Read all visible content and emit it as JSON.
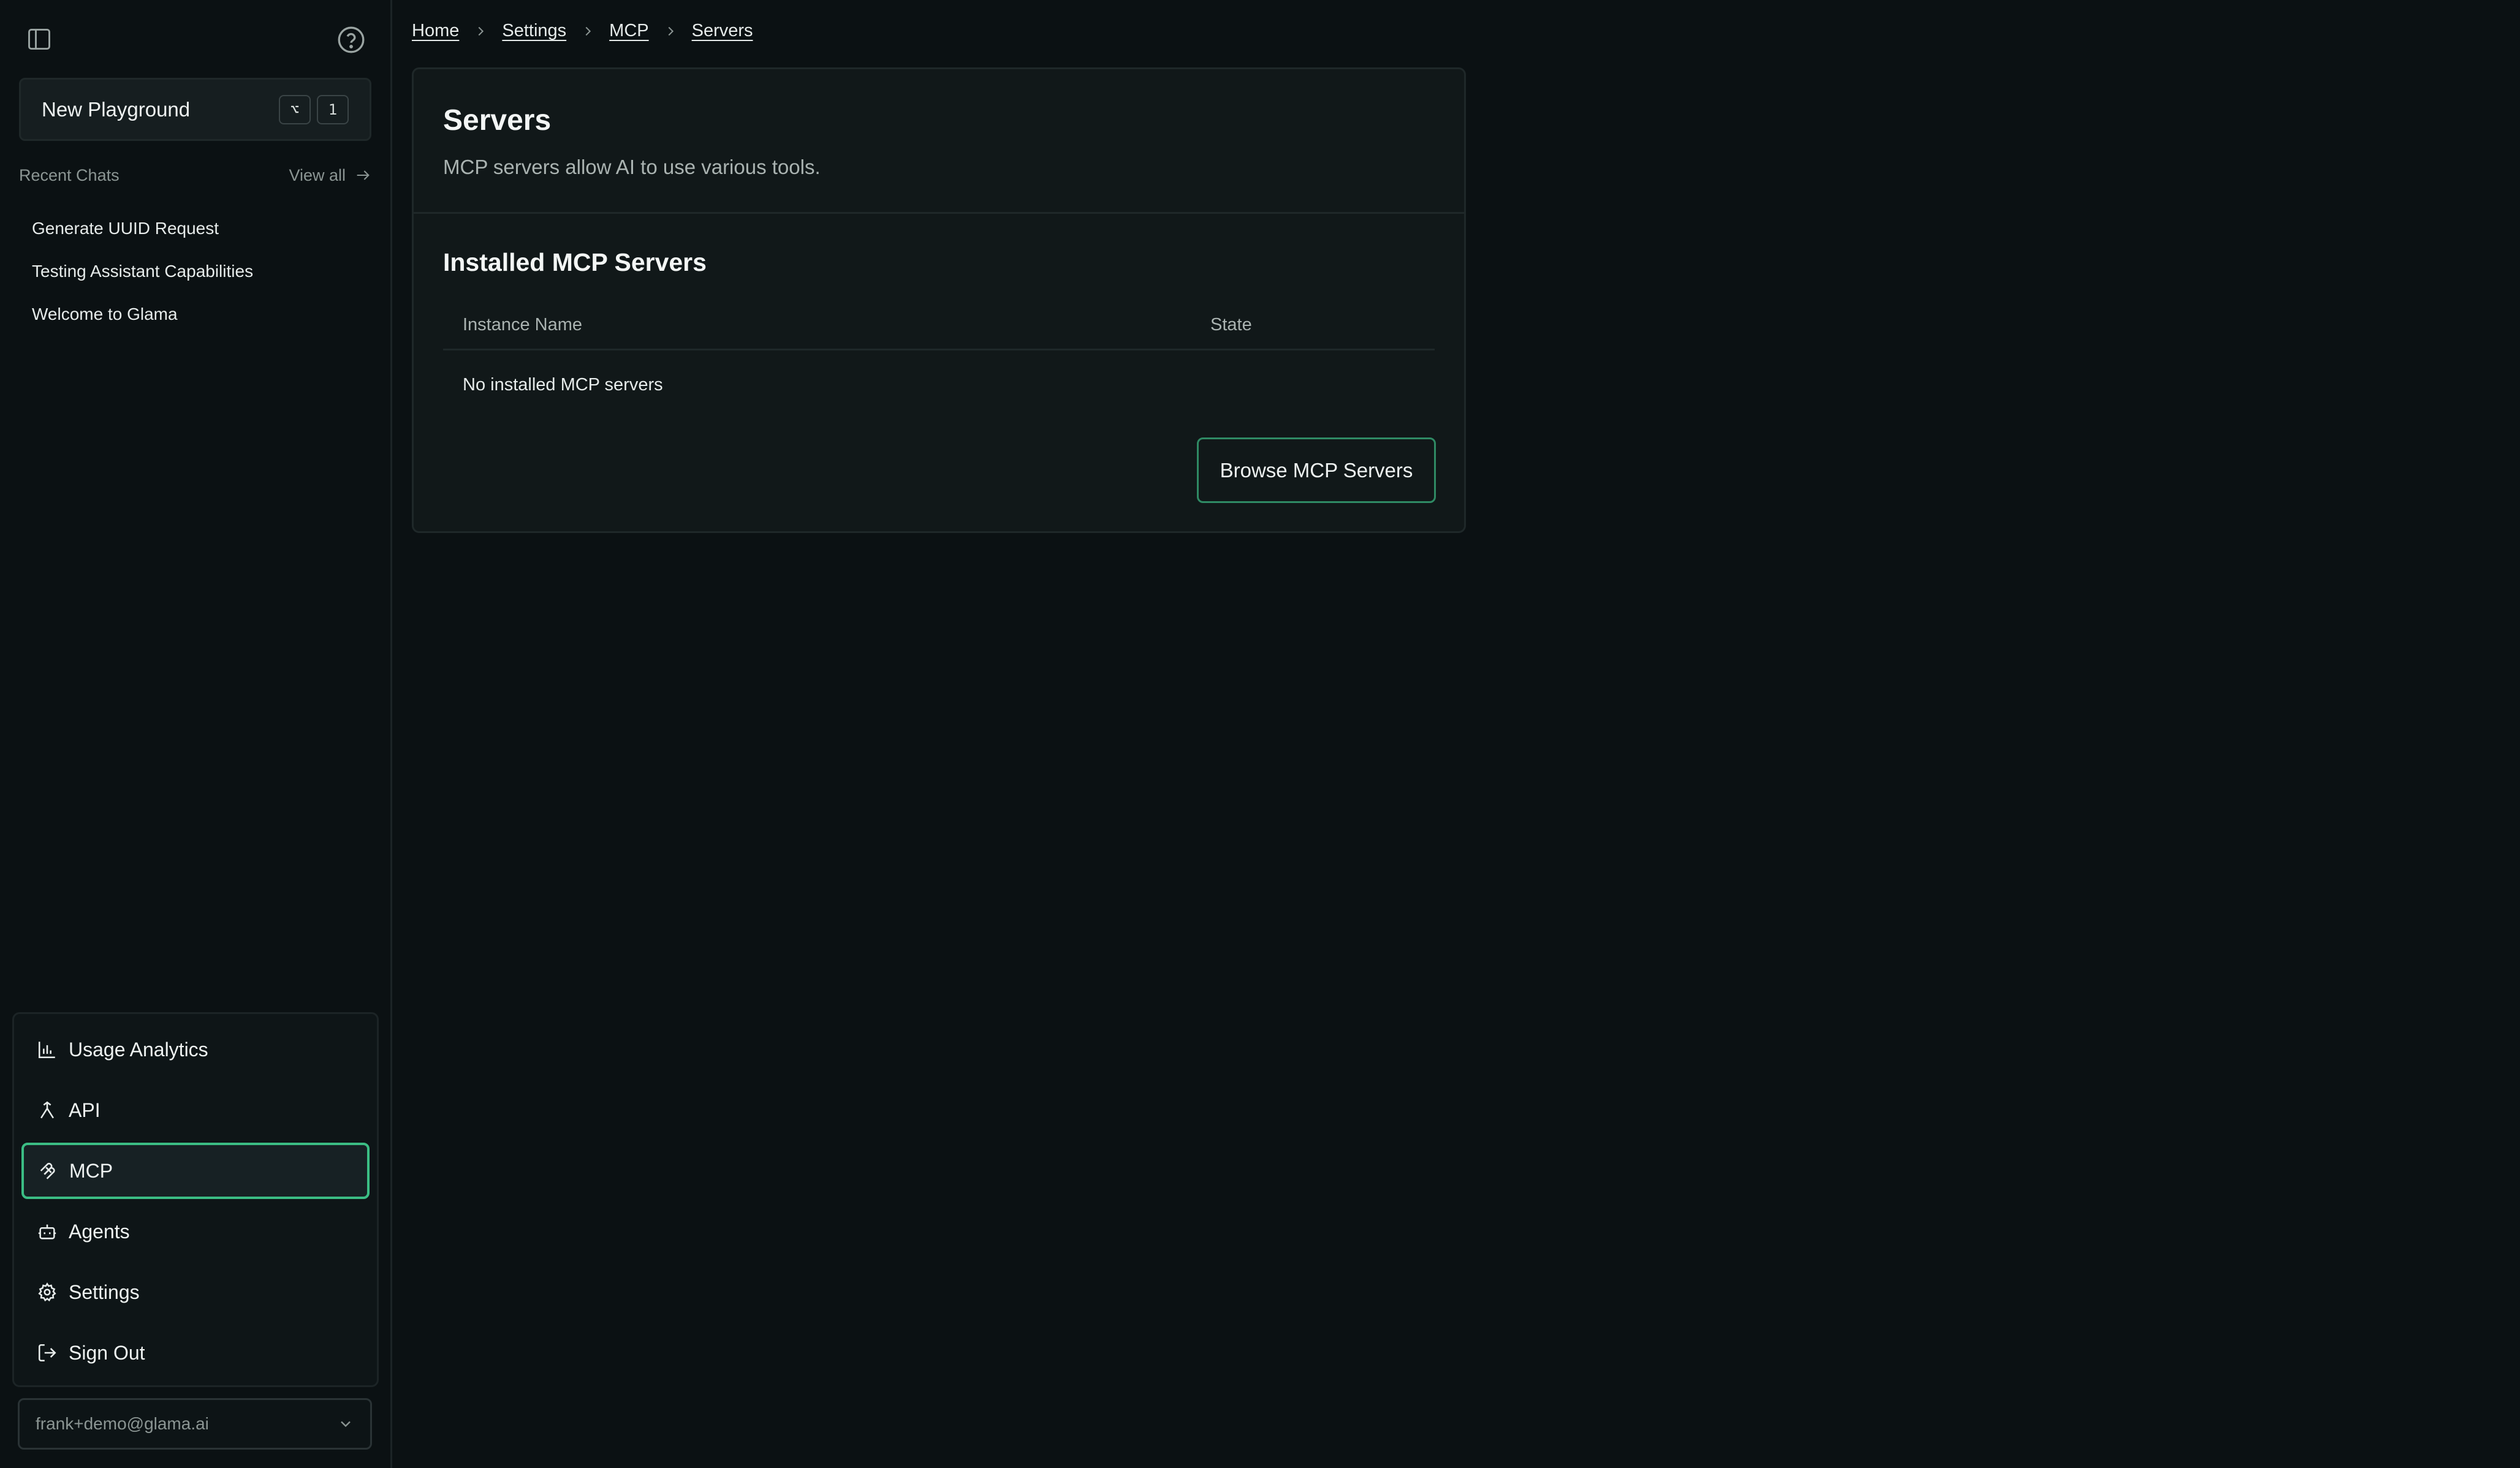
{
  "sidebar": {
    "new_playground": {
      "label": "New Playground",
      "shortcut": [
        "⌥",
        "1"
      ]
    },
    "recent_chats": {
      "title": "Recent Chats",
      "view_all": "View all",
      "items": [
        {
          "label": "Generate UUID Request"
        },
        {
          "label": "Testing Assistant Capabilities"
        },
        {
          "label": "Welcome to Glama"
        }
      ]
    },
    "menu": [
      {
        "label": "Usage Analytics",
        "icon": "bar-chart-icon"
      },
      {
        "label": "API",
        "icon": "api-icon"
      },
      {
        "label": "MCP",
        "icon": "mcp-icon",
        "active": true
      },
      {
        "label": "Agents",
        "icon": "bot-icon"
      },
      {
        "label": "Settings",
        "icon": "gear-icon"
      },
      {
        "label": "Sign Out",
        "icon": "sign-out-icon"
      }
    ],
    "user_email": "frank+demo@glama.ai"
  },
  "breadcrumb": [
    "Home",
    "Settings",
    "MCP",
    "Servers"
  ],
  "main": {
    "title": "Servers",
    "description": "MCP servers allow AI to use various tools.",
    "section_title": "Installed MCP Servers",
    "table": {
      "columns": [
        "Instance Name",
        "State"
      ],
      "empty_text": "No installed MCP servers"
    },
    "browse_button": "Browse MCP Servers"
  },
  "colors": {
    "background": "#0b1113",
    "card": "#111819",
    "accent": "#3bbd84"
  }
}
